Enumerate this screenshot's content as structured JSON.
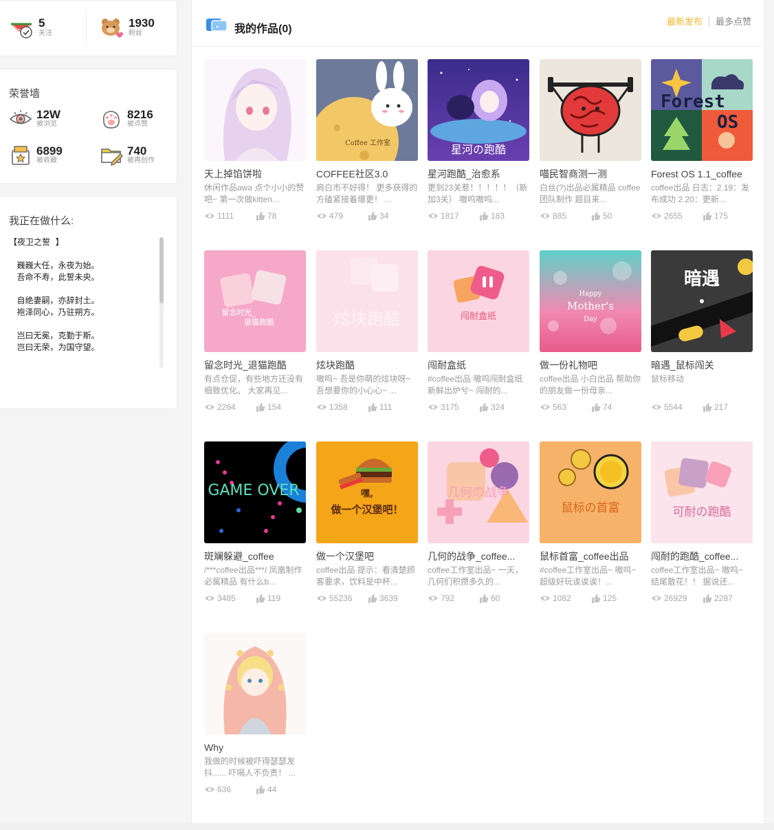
{
  "stats": {
    "follow": {
      "num": "5",
      "label": "关注"
    },
    "fans": {
      "num": "1930",
      "label": "粉丝"
    }
  },
  "honor": {
    "title": "荣誉墙",
    "views": {
      "num": "12W",
      "label": "被浏览"
    },
    "likes": {
      "num": "8216",
      "label": "被点赞"
    },
    "collects": {
      "num": "6899",
      "label": "被收藏"
    },
    "remix": {
      "num": "740",
      "label": "被再创作"
    }
  },
  "doing": {
    "title": "我正在做什么:",
    "text": "【夜卫之誓  】\n\n   巍巍大任，永夜为始。\n   吾命不寿，此誓未央。\n\n   自绝妻嗣，亦辞封土。\n   袍泽同心，乃驻朔方。\n\n   岂曰无冕，克勤于斯。\n   岂曰无荣，为国守望。"
  },
  "main": {
    "title": "我的作品(0)",
    "sort_latest": "最新发布",
    "sort_popular": "最多点赞"
  },
  "works": [
    {
      "title": "天上掉馅饼啦",
      "desc": "休闲作品awa 点个小小的赞吧~ 第一次做kitten...",
      "views": "1111",
      "likes": "78"
    },
    {
      "title": "COFFEE社区3.0",
      "desc": "肩白市不好得！ 更多获得的方磕紧接着爆更！ ...",
      "views": "479",
      "likes": "34"
    },
    {
      "title": "星河跑酷_治愈系",
      "desc": "更到23关惹！！！！！（新加3关） 嗷呜嗷呜...",
      "views": "1817",
      "likes": "183"
    },
    {
      "title": "喵民智商测一测",
      "desc": "白丝(?)出品必属精品 coffee团队制作 题目来...",
      "views": "885",
      "likes": "50"
    },
    {
      "title": "Forest OS 1.1_coffee",
      "desc": "coffee出品 日志：2.19：发布成功 2.20：更新...",
      "views": "2655",
      "likes": "175"
    },
    {
      "title": "留念时光_退猫跑酷",
      "desc": "有点仓促，有些地方还没有细致优化。 大家再见...",
      "views": "2264",
      "likes": "154"
    },
    {
      "title": "炫块跑酷",
      "desc": "嗷呜~ 吾是你萌的炫块呀~ 吾想要你的小心心~ ...",
      "views": "1358",
      "likes": "111"
    },
    {
      "title": "闯耐盒纸",
      "desc": "#coffee出品 嗷呜闯耐盒纸新鲜出炉兮~ 闯耐的...",
      "views": "3175",
      "likes": "324"
    },
    {
      "title": "做一份礼物吧",
      "desc": "coffee出品 小白出品 帮助你的朋友做一份母亲...",
      "views": "563",
      "likes": "74"
    },
    {
      "title": "暗遇_鼠标闯关",
      "desc": "鼠标移动",
      "views": "5544",
      "likes": "217"
    },
    {
      "title": "斑斓躲避_coffee",
      "desc": "/***coffee出品***/ 凤凰制作必属精品 有什么b...",
      "views": "3485",
      "likes": "119"
    },
    {
      "title": "做一个汉堡吧",
      "desc": "coffee出品 提示：看清楚顾客要求，饮料是中杯...",
      "views": "55236",
      "likes": "3639"
    },
    {
      "title": "几何的战争_coffee...",
      "desc": "coffee工作室出品~ 一天，几何们积攒多久的...",
      "views": "792",
      "likes": "60"
    },
    {
      "title": "鼠标首富_coffee出品",
      "desc": "#coffee工作室出品~ 嗷呜~ 超级好玩诶诶诶！...",
      "views": "1082",
      "likes": "125"
    },
    {
      "title": "闯耐的跑酷_coffee...",
      "desc": "coffee工作室出品~ 嗷呜~ 结尾散花！！ 据说还...",
      "views": "26929",
      "likes": "2287"
    },
    {
      "title": "Why",
      "desc": "我做的时候被吓得瑟瑟发抖...... 吓嗝人不负责！ ...",
      "views": "636",
      "likes": "44"
    }
  ],
  "thumb_texts": {
    "coffee_studio": "Coffee 工作室",
    "star_run": "星河の跑酷",
    "forest": "Forest",
    "os": "OS",
    "liunian": "留念时光_",
    "tuimao": "退猫跑酷",
    "xuankuai": "炫块跑酷",
    "naoshi": "闯耐盒纸",
    "happy": "Happy",
    "mothers": "Mother's",
    "day": "Day",
    "anyu": "暗遇",
    "gameover": "GAME OVER",
    "hei": "嘿,",
    "burger": "做一个汉堡吧！",
    "jihe": "几何の战争",
    "shubiao": "鼠标の首富",
    "kenai": "可耐の跑酷"
  },
  "colors": {
    "accent": "#f7b52c"
  }
}
